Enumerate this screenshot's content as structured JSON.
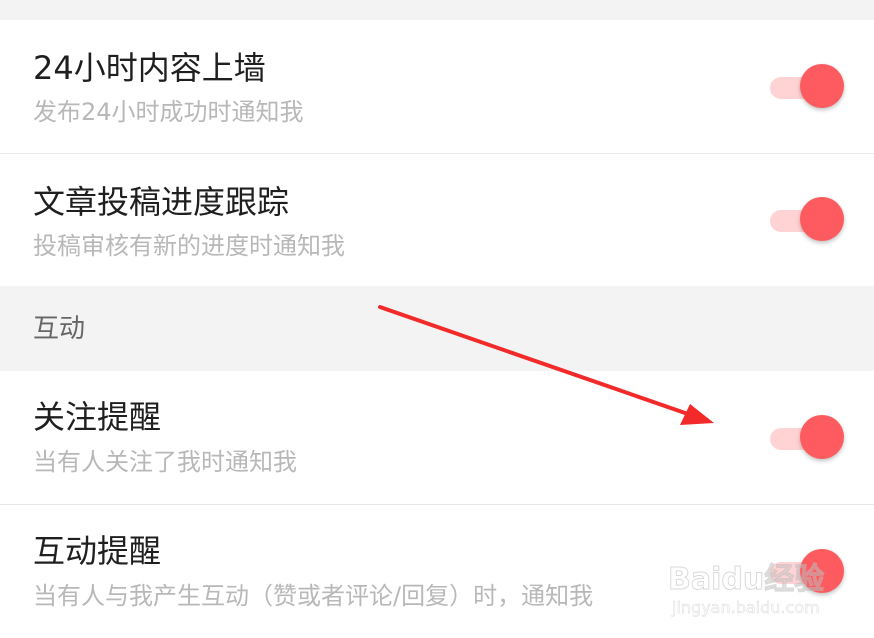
{
  "colors": {
    "accent": "#fd5b5f",
    "track": "#ffd3d3",
    "section_bg": "#f3f3f3",
    "title_text": "#1f1f1f",
    "subtitle_text": "#b8b8b8"
  },
  "settings": [
    {
      "title": "24小时内容上墙",
      "subtitle": "发布24小时成功时通知我",
      "enabled": true
    },
    {
      "title": "文章投稿进度跟踪",
      "subtitle": "投稿审核有新的进度时通知我",
      "enabled": true
    }
  ],
  "section": {
    "label": "互动"
  },
  "interaction_settings": [
    {
      "title": "关注提醒",
      "subtitle": "当有人关注了我时通知我",
      "enabled": true
    },
    {
      "title": "互动提醒",
      "subtitle": "当有人与我产生互动（赞或者评论/回复）时，通知我",
      "enabled": true
    }
  ],
  "watermark": {
    "logo_text": "Baidu经验",
    "url": "jingyan.baidu.com"
  }
}
